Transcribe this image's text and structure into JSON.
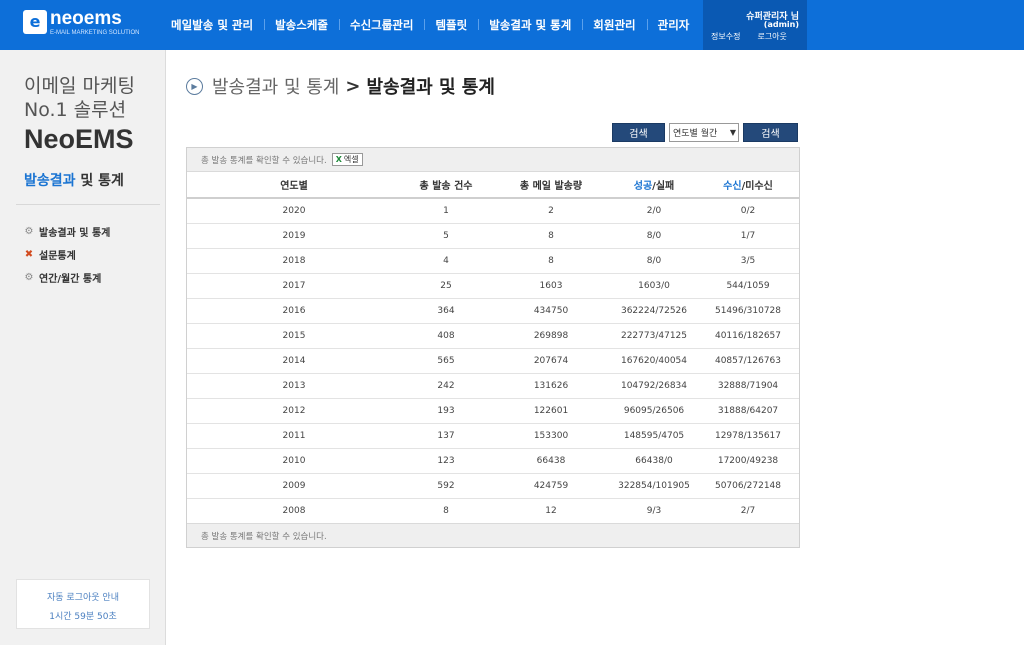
{
  "brand": {
    "mark": "e",
    "name": "neoems",
    "sub": "E-MAIL MARKETING SOLUTION"
  },
  "nav": [
    {
      "label": "메일발송 및 관리"
    },
    {
      "label": "발송스케줄"
    },
    {
      "label": "수신그룹관리"
    },
    {
      "label": "템플릿"
    },
    {
      "label": "발송결과 및 통계"
    },
    {
      "label": "회원관리"
    },
    {
      "label": "관리자"
    }
  ],
  "user": {
    "name": "슈퍼관리자 님",
    "id": "(admin)",
    "edit": "정보수정",
    "logout": "로그아웃"
  },
  "sidebar": {
    "hero_line1": "이메일 마케팅",
    "hero_line2": "No.1 솔루션",
    "hero_line3": "NeoEMS",
    "section_a": "발송결과",
    "section_b": "및 통계",
    "menu": [
      {
        "label": "발송결과 및 통계",
        "icon": "gear-icon"
      },
      {
        "label": "설문통계",
        "icon": "survey-icon"
      },
      {
        "label": "연간/월간 통계",
        "icon": "gear-icon"
      }
    ],
    "autologout_title": "자동 로그아웃 안내",
    "autologout_time": "1시간 59분 50초"
  },
  "breadcrumb": {
    "parent": "발송결과 및 통계",
    "separator": ">",
    "current": "발송결과 및 통계"
  },
  "controls": {
    "search1": "검색",
    "select_value": "연도별 월간",
    "search2": "검색"
  },
  "notes": {
    "top": "총 발송 통계를 확인할 수 있습니다.",
    "excel": "엑셀",
    "bottom": "총 발송 통계를 확인할 수 있습니다."
  },
  "table": {
    "headers": {
      "year": "연도별",
      "total_send": "총 발송 건수",
      "total_mail": "총 메일 발송량",
      "success_a": "성공",
      "success_b": "/실패",
      "recv_a": "수신",
      "recv_b": "/미수신"
    },
    "rows": [
      {
        "year": "2020",
        "sends": "1",
        "mails": "2",
        "success": "2",
        "fail": "/0",
        "recv": "0",
        "norecv": "/2"
      },
      {
        "year": "2019",
        "sends": "5",
        "mails": "8",
        "success": "8",
        "fail": "/0",
        "recv": "1",
        "norecv": "/7"
      },
      {
        "year": "2018",
        "sends": "4",
        "mails": "8",
        "success": "8",
        "fail": "/0",
        "recv": "3",
        "norecv": "/5"
      },
      {
        "year": "2017",
        "sends": "25",
        "mails": "1603",
        "success": "1603",
        "fail": "/0",
        "recv": "544",
        "norecv": "/1059"
      },
      {
        "year": "2016",
        "sends": "364",
        "mails": "434750",
        "success": "362224",
        "fail": "/72526",
        "recv": "51496",
        "norecv": "/310728"
      },
      {
        "year": "2015",
        "sends": "408",
        "mails": "269898",
        "success": "222773",
        "fail": "/47125",
        "recv": "40116",
        "norecv": "/182657"
      },
      {
        "year": "2014",
        "sends": "565",
        "mails": "207674",
        "success": "167620",
        "fail": "/40054",
        "recv": "40857",
        "norecv": "/126763"
      },
      {
        "year": "2013",
        "sends": "242",
        "mails": "131626",
        "success": "104792",
        "fail": "/26834",
        "recv": "32888",
        "norecv": "/71904"
      },
      {
        "year": "2012",
        "sends": "193",
        "mails": "122601",
        "success": "96095",
        "fail": "/26506",
        "recv": "31888",
        "norecv": "/64207"
      },
      {
        "year": "2011",
        "sends": "137",
        "mails": "153300",
        "success": "148595",
        "fail": "/4705",
        "recv": "12978",
        "norecv": "/135617"
      },
      {
        "year": "2010",
        "sends": "123",
        "mails": "66438",
        "success": "66438",
        "fail": "/0",
        "recv": "17200",
        "norecv": "/49238"
      },
      {
        "year": "2009",
        "sends": "592",
        "mails": "424759",
        "success": "322854",
        "fail": "/101905",
        "recv": "50706",
        "norecv": "/272148"
      },
      {
        "year": "2008",
        "sends": "8",
        "mails": "12",
        "success": "9",
        "fail": "/3",
        "recv": "2",
        "norecv": "/7"
      }
    ]
  },
  "colors": {
    "topbar": "#0d6fd9",
    "userbox": "#0a59b3",
    "link": "#1a74d2",
    "button": "#24497a"
  }
}
